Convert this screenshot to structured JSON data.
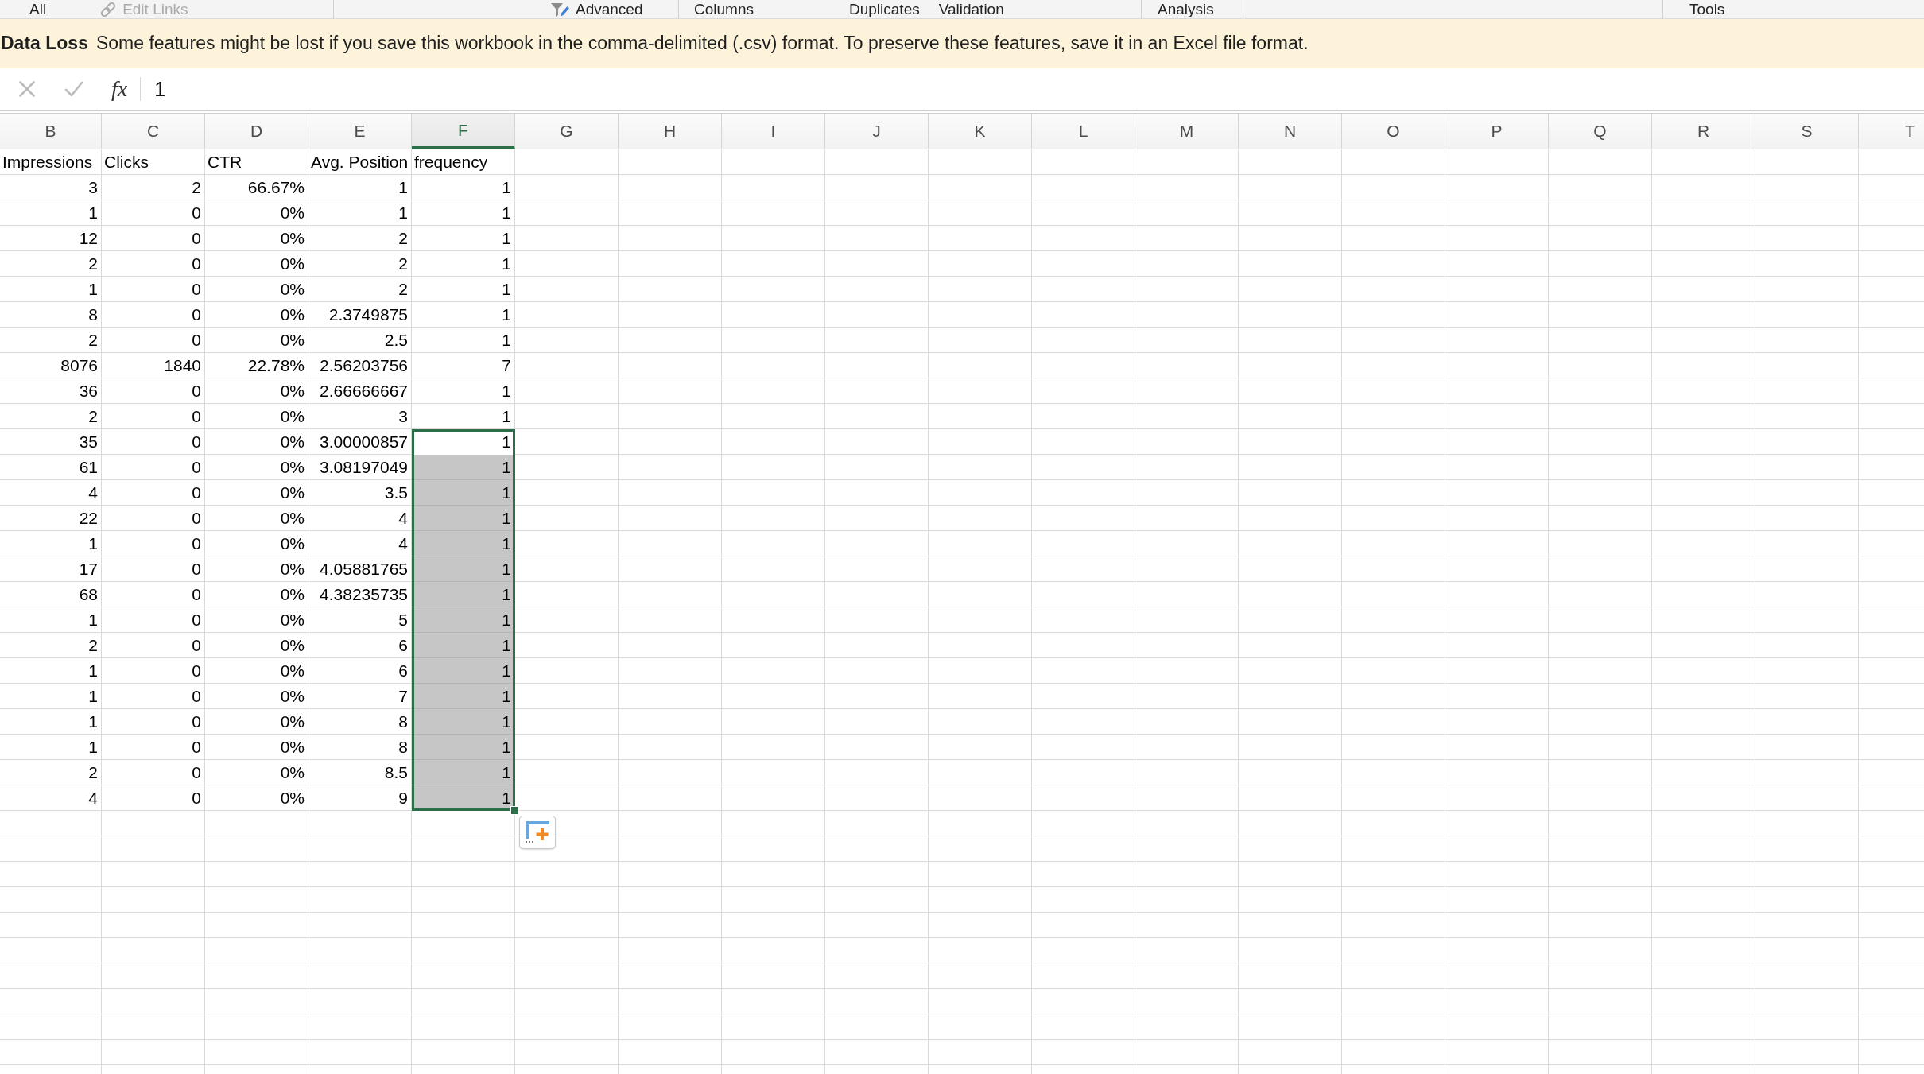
{
  "ribbon": {
    "groups": [
      {
        "items": [
          {
            "label": "All",
            "kind": "text",
            "disabled": false
          },
          {
            "label": "Edit Links",
            "kind": "link",
            "disabled": true
          }
        ]
      },
      {
        "items": [
          {
            "label": "Advanced",
            "kind": "filter",
            "disabled": false
          }
        ]
      },
      {
        "items": [
          {
            "label": "Columns",
            "kind": "text",
            "disabled": false
          },
          {
            "label": "Duplicates",
            "kind": "text",
            "disabled": false
          },
          {
            "label": "Validation",
            "kind": "text",
            "disabled": false
          }
        ]
      },
      {
        "items": [
          {
            "label": "Analysis",
            "kind": "text",
            "disabled": false
          }
        ]
      },
      {
        "items": [
          {
            "label": "Tools",
            "kind": "text",
            "disabled": false
          }
        ]
      }
    ]
  },
  "message_bar": {
    "title": "Data Loss",
    "text": "Some features might be lost if you save this workbook in the comma-delimited (.csv) format. To preserve these features, save it in an Excel file format."
  },
  "formula_bar": {
    "function_label": "fx",
    "value": "1"
  },
  "sheet": {
    "columns": [
      {
        "label": "B",
        "selected": false
      },
      {
        "label": "C",
        "selected": false
      },
      {
        "label": "D",
        "selected": false
      },
      {
        "label": "E",
        "selected": false
      },
      {
        "label": "F",
        "selected": true
      },
      {
        "label": "G",
        "selected": false
      },
      {
        "label": "H",
        "selected": false
      },
      {
        "label": "I",
        "selected": false
      },
      {
        "label": "J",
        "selected": false
      },
      {
        "label": "K",
        "selected": false
      },
      {
        "label": "L",
        "selected": false
      },
      {
        "label": "M",
        "selected": false
      },
      {
        "label": "N",
        "selected": false
      },
      {
        "label": "O",
        "selected": false
      },
      {
        "label": "P",
        "selected": false
      },
      {
        "label": "Q",
        "selected": false
      },
      {
        "label": "R",
        "selected": false
      },
      {
        "label": "S",
        "selected": false
      },
      {
        "label": "T",
        "selected": false
      }
    ],
    "header_row": [
      "Impressions",
      "Clicks",
      "CTR",
      "Avg. Position",
      "frequency"
    ],
    "rows": [
      {
        "cells": [
          "3",
          "2",
          "66.67%",
          "1",
          "1"
        ],
        "selected": false,
        "active": false
      },
      {
        "cells": [
          "1",
          "0",
          "0%",
          "1",
          "1"
        ],
        "selected": false,
        "active": false
      },
      {
        "cells": [
          "12",
          "0",
          "0%",
          "2",
          "1"
        ],
        "selected": false,
        "active": false
      },
      {
        "cells": [
          "2",
          "0",
          "0%",
          "2",
          "1"
        ],
        "selected": false,
        "active": false
      },
      {
        "cells": [
          "1",
          "0",
          "0%",
          "2",
          "1"
        ],
        "selected": false,
        "active": false
      },
      {
        "cells": [
          "8",
          "0",
          "0%",
          "2.3749875",
          "1"
        ],
        "selected": false,
        "active": false
      },
      {
        "cells": [
          "2",
          "0",
          "0%",
          "2.5",
          "1"
        ],
        "selected": false,
        "active": false
      },
      {
        "cells": [
          "8076",
          "1840",
          "22.78%",
          "2.56203756",
          "7"
        ],
        "selected": false,
        "active": false
      },
      {
        "cells": [
          "36",
          "0",
          "0%",
          "2.66666667",
          "1"
        ],
        "selected": false,
        "active": false
      },
      {
        "cells": [
          "2",
          "0",
          "0%",
          "3",
          "1"
        ],
        "selected": false,
        "active": false
      },
      {
        "cells": [
          "35",
          "0",
          "0%",
          "3.00000857",
          "1"
        ],
        "selected": true,
        "active": true
      },
      {
        "cells": [
          "61",
          "0",
          "0%",
          "3.08197049",
          "1"
        ],
        "selected": true,
        "active": false
      },
      {
        "cells": [
          "4",
          "0",
          "0%",
          "3.5",
          "1"
        ],
        "selected": true,
        "active": false
      },
      {
        "cells": [
          "22",
          "0",
          "0%",
          "4",
          "1"
        ],
        "selected": true,
        "active": false
      },
      {
        "cells": [
          "1",
          "0",
          "0%",
          "4",
          "1"
        ],
        "selected": true,
        "active": false
      },
      {
        "cells": [
          "17",
          "0",
          "0%",
          "4.05881765",
          "1"
        ],
        "selected": true,
        "active": false
      },
      {
        "cells": [
          "68",
          "0",
          "0%",
          "4.38235735",
          "1"
        ],
        "selected": true,
        "active": false
      },
      {
        "cells": [
          "1",
          "0",
          "0%",
          "5",
          "1"
        ],
        "selected": true,
        "active": false
      },
      {
        "cells": [
          "2",
          "0",
          "0%",
          "6",
          "1"
        ],
        "selected": true,
        "active": false
      },
      {
        "cells": [
          "1",
          "0",
          "0%",
          "6",
          "1"
        ],
        "selected": true,
        "active": false
      },
      {
        "cells": [
          "1",
          "0",
          "0%",
          "7",
          "1"
        ],
        "selected": true,
        "active": false
      },
      {
        "cells": [
          "1",
          "0",
          "0%",
          "8",
          "1"
        ],
        "selected": true,
        "active": false
      },
      {
        "cells": [
          "1",
          "0",
          "0%",
          "8",
          "1"
        ],
        "selected": true,
        "active": false
      },
      {
        "cells": [
          "2",
          "0",
          "0%",
          "8.5",
          "1"
        ],
        "selected": true,
        "active": false
      },
      {
        "cells": [
          "4",
          "0",
          "0%",
          "9",
          "1"
        ],
        "selected": true,
        "active": false
      }
    ]
  }
}
